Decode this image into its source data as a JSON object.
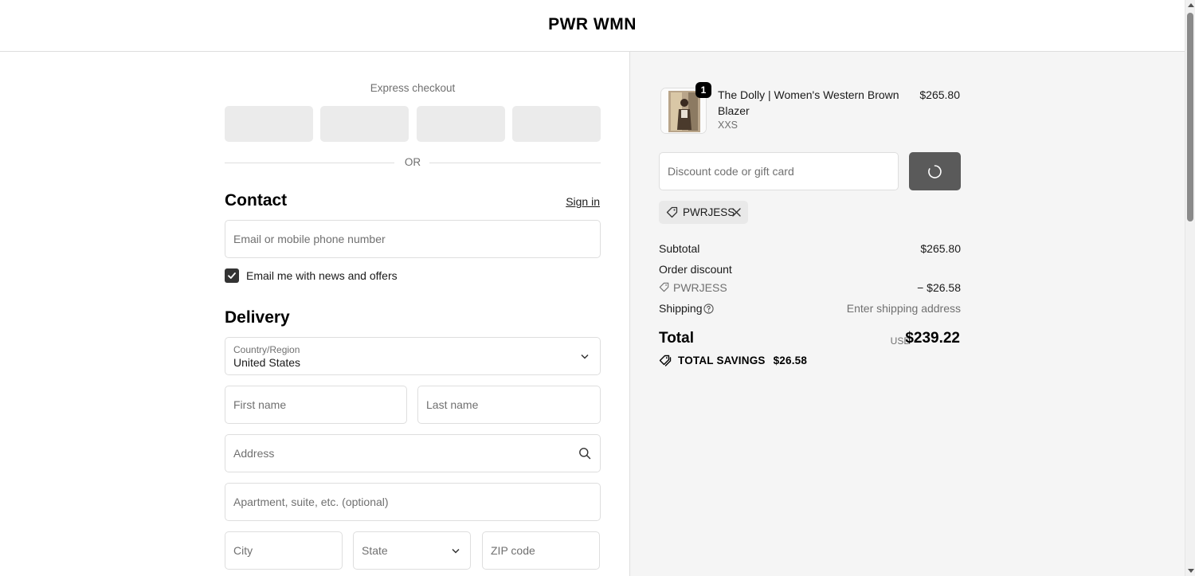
{
  "header": {
    "brand": "PWR WMN"
  },
  "express": {
    "title": "Express checkout",
    "or_label": "OR"
  },
  "contact": {
    "title": "Contact",
    "sign_in": "Sign in",
    "email_placeholder": "Email or mobile phone number",
    "newsletter_label": "Email me with news and offers",
    "newsletter_checked": true
  },
  "delivery": {
    "title": "Delivery",
    "country_label": "Country/Region",
    "country_value": "United States",
    "first_name_placeholder": "First name",
    "last_name_placeholder": "Last name",
    "address_placeholder": "Address",
    "apartment_placeholder": "Apartment, suite, etc. (optional)",
    "city_placeholder": "City",
    "state_placeholder": "State",
    "zip_placeholder": "ZIP code"
  },
  "summary": {
    "product": {
      "quantity": "1",
      "name": "The Dolly | Women's Western Brown Blazer",
      "variant": "XXS",
      "price": "$265.80"
    },
    "discount_placeholder": "Discount code or gift card",
    "applied_code": "PWRJESS",
    "subtotal_label": "Subtotal",
    "subtotal_value": "$265.80",
    "order_discount_label": "Order discount",
    "discount_code": "PWRJESS",
    "discount_value": "− $26.58",
    "shipping_label": "Shipping",
    "shipping_value": "Enter shipping address",
    "total_label": "Total",
    "total_currency": "USD",
    "total_value": "$239.22",
    "savings_label": "TOTAL SAVINGS",
    "savings_value": "$26.58"
  }
}
